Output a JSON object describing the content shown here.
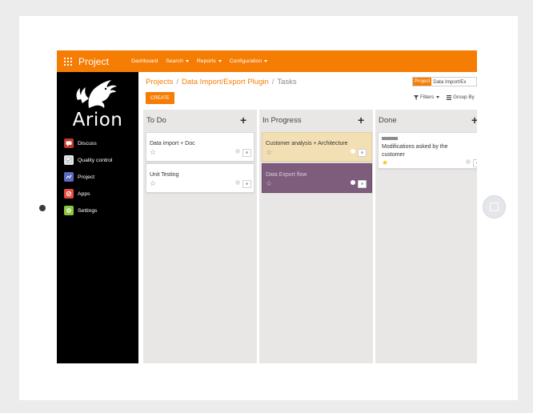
{
  "app": {
    "title": "Project"
  },
  "topnav": [
    {
      "label": "Dashboard",
      "dropdown": false
    },
    {
      "label": "Search",
      "dropdown": true
    },
    {
      "label": "Reports",
      "dropdown": true
    },
    {
      "label": "Configuration",
      "dropdown": true
    }
  ],
  "logo_text": "Arion",
  "sidebar": {
    "items": [
      {
        "label": "Discuss",
        "icon": "discuss-icon",
        "color": "#c0392b"
      },
      {
        "label": "Quality control",
        "icon": "quality-control-icon",
        "color": "#dddddd"
      },
      {
        "label": "Project",
        "icon": "project-icon",
        "color": "#5b6abf"
      },
      {
        "label": "Apps",
        "icon": "apps-icon",
        "color": "#e74c3c"
      },
      {
        "label": "Settings",
        "icon": "settings-icon",
        "color": "#8cc63f"
      }
    ]
  },
  "breadcrumb": {
    "items": [
      "Projects",
      "Data Import/Export Plugin"
    ],
    "current": "Tasks"
  },
  "search": {
    "facet_label": "Project",
    "facet_value": "Data Import/Ex"
  },
  "create_label": "CREATE",
  "tools": {
    "filters": "Filters",
    "group_by": "Group By"
  },
  "columns": [
    {
      "title": "To Do",
      "cards": [
        {
          "title": "Data import + Doc",
          "starred": false
        },
        {
          "title": "Unit Testing",
          "starred": false
        }
      ]
    },
    {
      "title": "In Progress",
      "cards": [
        {
          "title": "Customer analysis + Architecture",
          "starred": false,
          "color": "#f3dfb4"
        },
        {
          "title": "Data Export flow",
          "starred": false,
          "color": "#7d5c7c"
        }
      ]
    },
    {
      "title": "Done",
      "cards": [
        {
          "title": "Modifications asked by the customer",
          "starred": true
        }
      ]
    }
  ],
  "colors": {
    "accent": "#f57d04",
    "sidebar": "#000000",
    "column_bg": "#e9e6e6"
  }
}
